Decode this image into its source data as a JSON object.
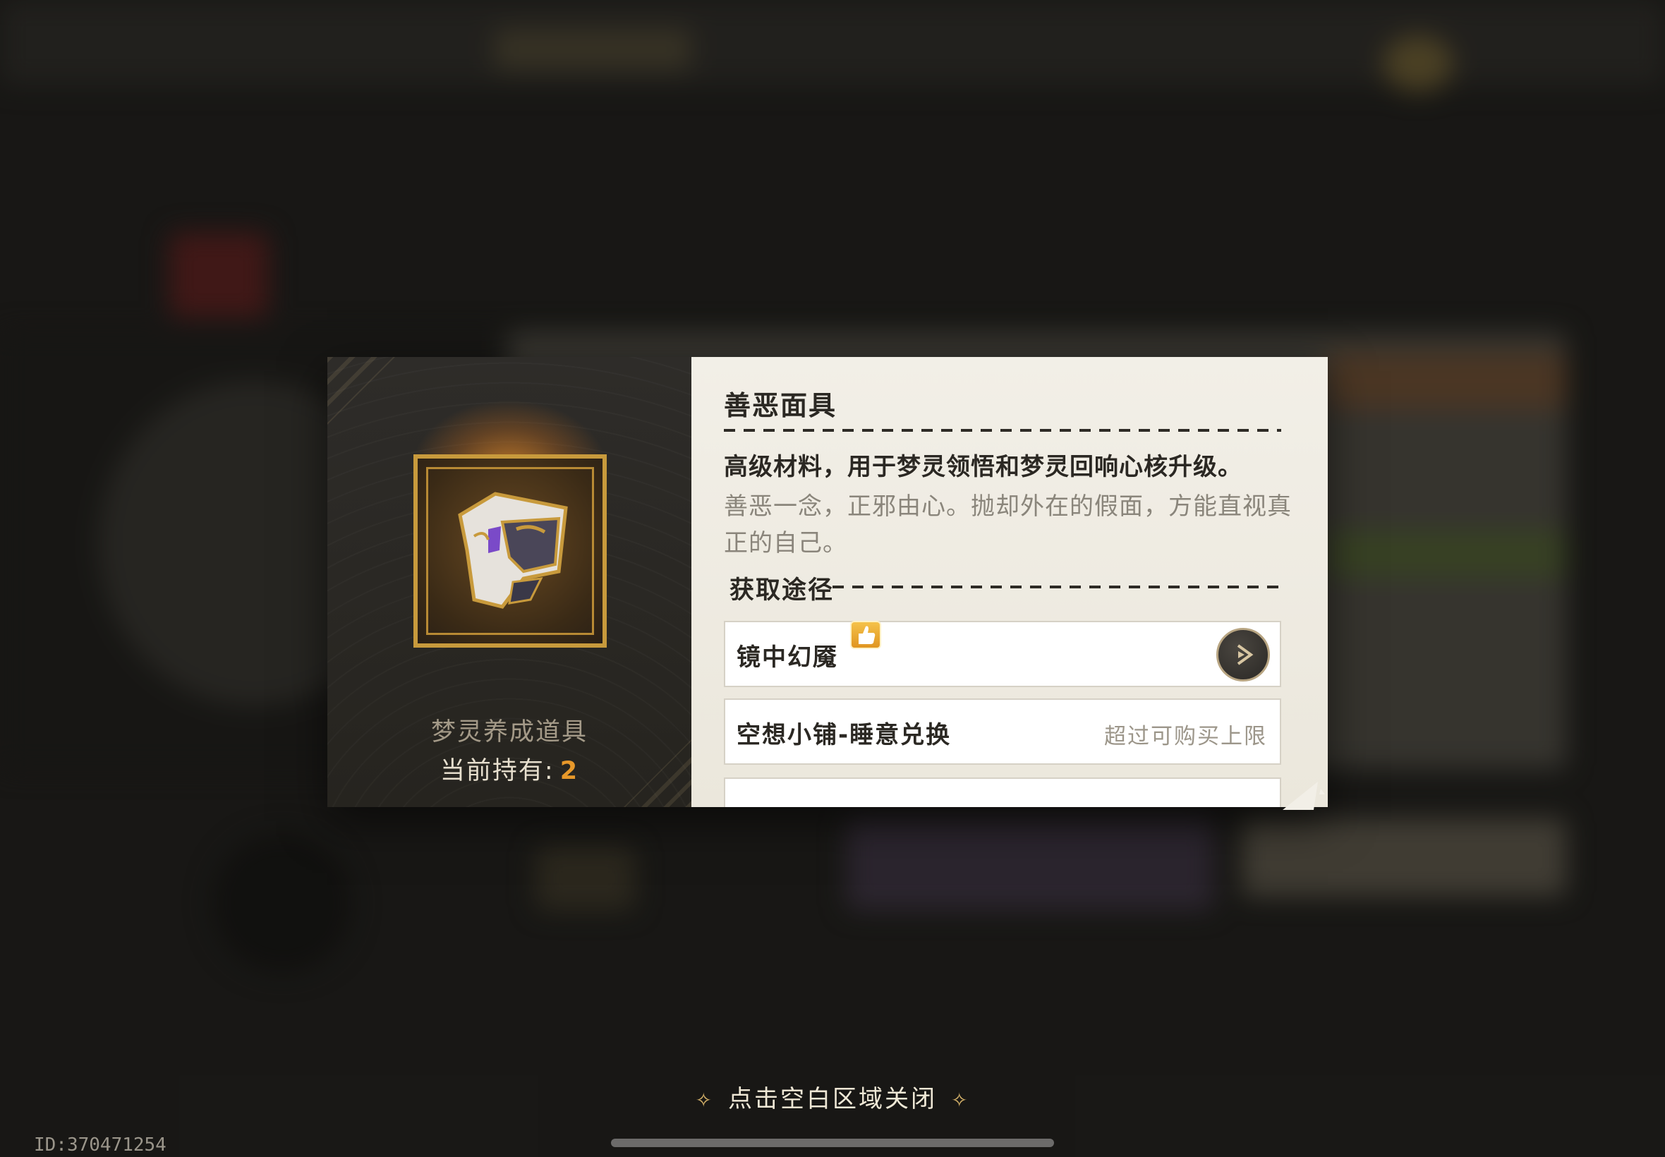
{
  "item": {
    "name": "善恶面具",
    "description": "高级材料，用于梦灵领悟和梦灵回响心核升级。",
    "flavor_text": "善恶一念，正邪由心。抛却外在的假面，方能直视真正的自己。",
    "category": "梦灵养成道具",
    "owned_label": "当前持有:",
    "owned_count": "2",
    "icon": "mask-icon"
  },
  "sources": {
    "title": "获取途径",
    "items": [
      {
        "label": "镜中幻魇",
        "badge": "thumbs-up-icon",
        "action_icon": "go-arrow-icon"
      },
      {
        "label": "空想小铺-睡意兑换",
        "status": "超过可购买上限"
      }
    ]
  },
  "footer": {
    "close_hint": "点击空白区域关闭",
    "id_text": "ID:370471254"
  },
  "colors": {
    "accent_orange": "#e7982a",
    "gold_frame": "#c89a3c",
    "panel_dark": "#2e2c29",
    "panel_light": "#f2efe7"
  }
}
